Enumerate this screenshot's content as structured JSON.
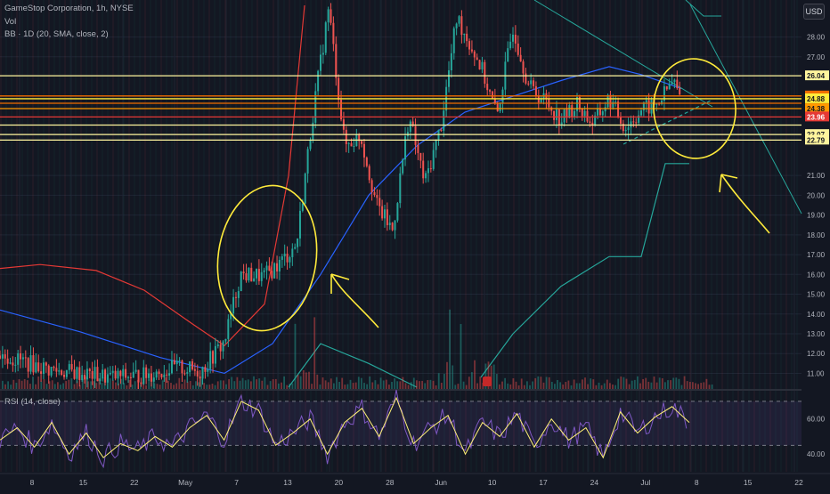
{
  "header": {
    "symbol_line": "GameStop Corporation, 1h, NYSE",
    "volume_label": "Vol",
    "bb_label": "BB · 1D (20, SMA, close, 2)",
    "rsi_label": "RSI (14, close)",
    "currency_button": "USD"
  },
  "colors": {
    "background": "#131722",
    "grid": "#1f2433",
    "up": "#26a69a",
    "down": "#ef5350",
    "bb_basis": "#2962ff",
    "bb_upper": "#e53935",
    "bb_lower": "#26a69a",
    "annotation": "#ffeb3b",
    "trendline": "#26a69a",
    "rsi_line": "#7e57c2",
    "rsi_ma": "#fff176",
    "rsi_band": "rgba(126,87,194,0.12)"
  },
  "chart_data": {
    "type": "candlestick",
    "title": "GameStop Corporation, 1h, NYSE",
    "x_ticks": [
      "8",
      "15",
      "22",
      "May",
      "7",
      "13",
      "20",
      "28",
      "Jun",
      "10",
      "17",
      "24",
      "Jul",
      "8",
      "15",
      "22"
    ],
    "price_axis": {
      "ticks": [
        "28.00",
        "27.00",
        "21.00",
        "20.00",
        "19.00",
        "18.00",
        "17.00",
        "16.00",
        "15.00",
        "14.00",
        "13.00",
        "12.00",
        "11.00"
      ],
      "ylim": [
        10.3,
        29.6
      ],
      "scale": "linear"
    },
    "horizontal_levels": [
      {
        "price": 26.04,
        "label": "26.04",
        "color": "#fff59d",
        "text": "#131722"
      },
      {
        "price": 25.02,
        "label": "25.02",
        "color": "#ef6c00",
        "text": "#131722"
      },
      {
        "price": 24.88,
        "label": "24.88",
        "color": "#ffeb3b",
        "text": "#131722"
      },
      {
        "price": 24.65,
        "label": "",
        "color": "#ef6c00",
        "text": "#131722"
      },
      {
        "price": 24.38,
        "label": "24.38",
        "color": "#ff9800",
        "text": "#131722"
      },
      {
        "price": 23.96,
        "label": "23.96",
        "color": "#e53935",
        "text": "#ffffff"
      },
      {
        "price": 23.55,
        "label": "",
        "color": "#fff59d",
        "text": "#131722"
      },
      {
        "price": 23.07,
        "label": "23.07",
        "color": "#fff59d",
        "text": "#131722"
      },
      {
        "price": 22.79,
        "label": "22.79",
        "color": "#fff59d",
        "text": "#131722"
      }
    ],
    "price_path": [
      {
        "x": 0,
        "y": 11.9
      },
      {
        "x": 0.03,
        "y": 11.6
      },
      {
        "x": 0.06,
        "y": 11.2
      },
      {
        "x": 0.1,
        "y": 11.0
      },
      {
        "x": 0.14,
        "y": 10.8
      },
      {
        "x": 0.18,
        "y": 10.9
      },
      {
        "x": 0.22,
        "y": 11.3
      },
      {
        "x": 0.25,
        "y": 11.1
      },
      {
        "x": 0.28,
        "y": 12.6
      },
      {
        "x": 0.3,
        "y": 16.0
      },
      {
        "x": 0.33,
        "y": 15.9
      },
      {
        "x": 0.35,
        "y": 16.6
      },
      {
        "x": 0.37,
        "y": 17.5
      },
      {
        "x": 0.39,
        "y": 24.0
      },
      {
        "x": 0.41,
        "y": 29.5
      },
      {
        "x": 0.43,
        "y": 22.5
      },
      {
        "x": 0.45,
        "y": 23.0
      },
      {
        "x": 0.47,
        "y": 19.5
      },
      {
        "x": 0.49,
        "y": 18.2
      },
      {
        "x": 0.51,
        "y": 24.0
      },
      {
        "x": 0.53,
        "y": 20.6
      },
      {
        "x": 0.55,
        "y": 23.5
      },
      {
        "x": 0.57,
        "y": 29.0
      },
      {
        "x": 0.6,
        "y": 26.5
      },
      {
        "x": 0.62,
        "y": 24.0
      },
      {
        "x": 0.64,
        "y": 28.5
      },
      {
        "x": 0.66,
        "y": 25.5
      },
      {
        "x": 0.68,
        "y": 24.8
      },
      {
        "x": 0.7,
        "y": 23.8
      },
      {
        "x": 0.72,
        "y": 24.6
      },
      {
        "x": 0.74,
        "y": 23.6
      },
      {
        "x": 0.76,
        "y": 24.9
      },
      {
        "x": 0.78,
        "y": 23.4
      },
      {
        "x": 0.8,
        "y": 24.3
      },
      {
        "x": 0.82,
        "y": 24.6
      },
      {
        "x": 0.84,
        "y": 25.8
      },
      {
        "x": 0.85,
        "y": 24.8
      }
    ],
    "bb_basis": [
      {
        "x": 0,
        "y": 14.2
      },
      {
        "x": 0.1,
        "y": 13.1
      },
      {
        "x": 0.2,
        "y": 11.8
      },
      {
        "x": 0.28,
        "y": 11.0
      },
      {
        "x": 0.34,
        "y": 12.5
      },
      {
        "x": 0.4,
        "y": 16.0
      },
      {
        "x": 0.46,
        "y": 20.0
      },
      {
        "x": 0.52,
        "y": 22.5
      },
      {
        "x": 0.58,
        "y": 24.2
      },
      {
        "x": 0.64,
        "y": 25.0
      },
      {
        "x": 0.7,
        "y": 25.8
      },
      {
        "x": 0.76,
        "y": 26.5
      },
      {
        "x": 0.8,
        "y": 26.1
      },
      {
        "x": 0.85,
        "y": 25.4
      }
    ],
    "bb_upper": [
      {
        "x": 0,
        "y": 16.3
      },
      {
        "x": 0.05,
        "y": 16.5
      },
      {
        "x": 0.12,
        "y": 16.2
      },
      {
        "x": 0.18,
        "y": 15.2
      },
      {
        "x": 0.24,
        "y": 13.5
      },
      {
        "x": 0.28,
        "y": 12.4
      },
      {
        "x": 0.33,
        "y": 14.5
      },
      {
        "x": 0.36,
        "y": 21.0
      },
      {
        "x": 0.38,
        "y": 29.6
      }
    ],
    "bb_lower": [
      {
        "x": 0.36,
        "y": 10.3
      },
      {
        "x": 0.4,
        "y": 12.5
      },
      {
        "x": 0.46,
        "y": 11.5
      },
      {
        "x": 0.52,
        "y": 10.3
      }
    ],
    "bb_lower_late": [
      {
        "x": 0.6,
        "y": 10.8
      },
      {
        "x": 0.64,
        "y": 13.0
      },
      {
        "x": 0.7,
        "y": 15.4
      },
      {
        "x": 0.76,
        "y": 16.9
      },
      {
        "x": 0.8,
        "y": 16.9
      },
      {
        "x": 0.83,
        "y": 21.6
      },
      {
        "x": 0.86,
        "y": 21.6
      }
    ],
    "rsi": {
      "ticks": [
        "60.00",
        "40.00"
      ],
      "ylim": [
        30,
        75
      ],
      "band": [
        45,
        70
      ],
      "values": [
        48,
        55,
        44,
        58,
        40,
        52,
        38,
        46,
        42,
        50,
        44,
        55,
        62,
        48,
        70,
        65,
        45,
        52,
        60,
        40,
        58,
        66,
        50,
        72,
        46,
        55,
        62,
        40,
        58,
        50,
        63,
        44,
        60,
        48,
        55,
        38,
        64,
        52,
        61,
        67,
        58
      ]
    }
  }
}
